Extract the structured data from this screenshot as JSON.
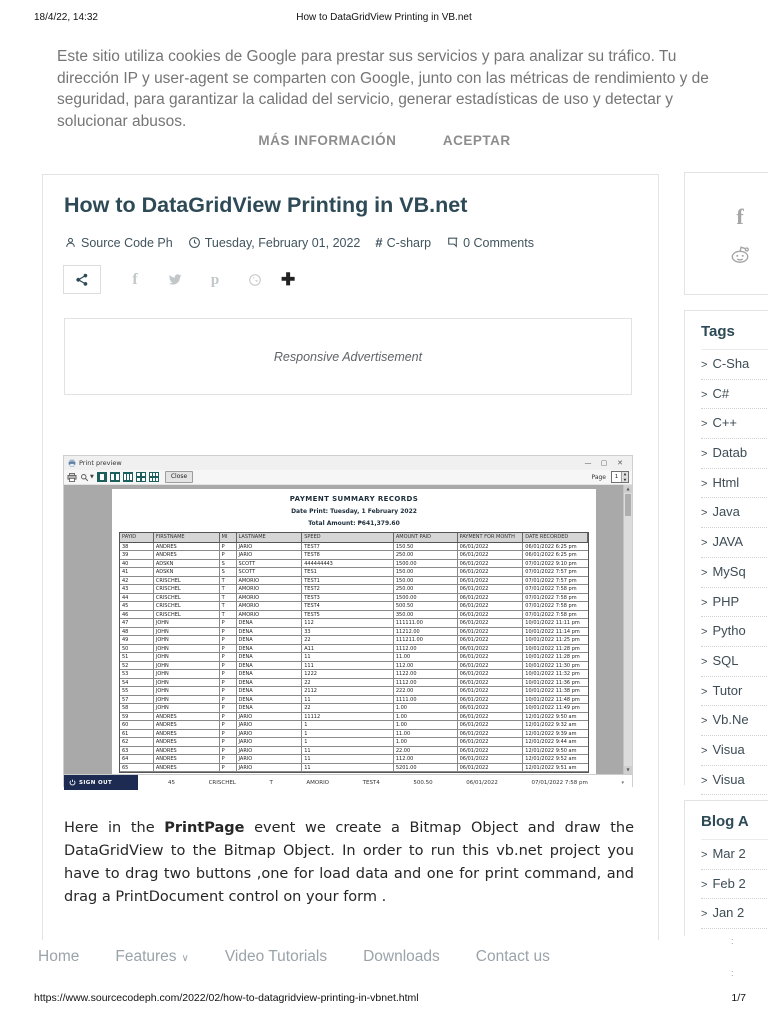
{
  "print_header": {
    "datetime": "18/4/22, 14:32",
    "title": "How to DataGridView Printing in VB.net"
  },
  "cookie_notice": {
    "text": "Este sitio utiliza cookies de Google para prestar sus servicios y para analizar su tráfico. Tu dirección IP y user-agent se comparten con Google, junto con las métricas de rendimiento y de seguridad, para garantizar la calidad del servicio, generar estadísticas de uso y detectar y solucionar abusos.",
    "more_label": "MÁS INFORMACIÓN",
    "accept_label": "ACEPTAR"
  },
  "article": {
    "title": "How to DataGridView Printing in VB.net",
    "author": "Source Code Ph",
    "date": "Tuesday, February 01, 2022",
    "tag": "C-sharp",
    "comments": "0 Comments",
    "ad_label": "Responsive Advertisement",
    "paragraph": {
      "before": "Here in the ",
      "bold": "PrintPage",
      "after": " event we create a Bitmap Object and draw the DataGridView to the Bitmap Object. In order to run this vb.net project you have to drag two buttons ,one for load data and one for print command, and drag a PrintDocument control on your form ."
    }
  },
  "preview_window": {
    "title": "Print preview",
    "close_label": "Close",
    "page_label": "Page",
    "page_value": "1",
    "minimize_glyph": "—",
    "maximize_glyph": "▢",
    "close_glyph": "✕",
    "report": {
      "title": "PAYMENT SUMMARY RECORDS",
      "date_line": "Date Print: Tuesday, 1 February 2022",
      "total_line": "Total Amount: ₱641,379.60",
      "columns": [
        "PAYID",
        "FIRSTNAME",
        "MI",
        "LASTNAME",
        "SPEED",
        "AMOUNT PAID",
        "PAYMENT FOR MONTH",
        "DATE RECORDED"
      ],
      "rows": [
        [
          "38",
          "ANDRES",
          "P",
          "JARIO",
          "TEST7",
          "150.50",
          "06/01/2022",
          "06/01/2022 6:25 pm"
        ],
        [
          "39",
          "ANDRES",
          "P",
          "JARIO",
          "TEST8",
          "250.00",
          "06/01/2022",
          "06/01/2022 6:25 pm"
        ],
        [
          "40",
          "ADSKN",
          "S",
          "SCOTT",
          "444444443",
          "1500.00",
          "06/01/2022",
          "07/01/2022 9:10 pm"
        ],
        [
          "41",
          "ADSKN",
          "S",
          "SCOTT",
          "TES1",
          "150.00",
          "06/01/2022",
          "07/01/2022 7:57 pm"
        ],
        [
          "42",
          "CRISCHEL",
          "T",
          "AMORIO",
          "TEST1",
          "150.00",
          "06/01/2022",
          "07/01/2022 7:57 pm"
        ],
        [
          "43",
          "CRISCHEL",
          "T",
          "AMORIO",
          "TEST2",
          "250.00",
          "06/01/2022",
          "07/01/2022 7:58 pm"
        ],
        [
          "44",
          "CRISCHEL",
          "T",
          "AMORIO",
          "TEST3",
          "1500.00",
          "06/01/2022",
          "07/01/2022 7:58 pm"
        ],
        [
          "45",
          "CRISCHEL",
          "T",
          "AMORIO",
          "TEST4",
          "500.50",
          "06/01/2022",
          "07/01/2022 7:58 pm"
        ],
        [
          "46",
          "CRISCHEL",
          "T",
          "AMORIO",
          "TEST5",
          "350.00",
          "06/01/2022",
          "07/01/2022 7:58 pm"
        ],
        [
          "47",
          "JOHN",
          "P",
          "DENA",
          "112",
          "111111.00",
          "06/01/2022",
          "10/01/2022 11:11 pm"
        ],
        [
          "48",
          "JOHN",
          "P",
          "DENA",
          "33",
          "11212.00",
          "06/01/2022",
          "10/01/2022 11:14 pm"
        ],
        [
          "49",
          "JOHN",
          "P",
          "DENA",
          "22",
          "111211.00",
          "06/01/2022",
          "10/01/2022 11:25 pm"
        ],
        [
          "50",
          "JOHN",
          "P",
          "DENA",
          "A11",
          "1112.00",
          "06/01/2022",
          "10/01/2022 11:28 pm"
        ],
        [
          "51",
          "JOHN",
          "P",
          "DENA",
          "11",
          "11.00",
          "06/01/2022",
          "10/01/2022 11:28 pm"
        ],
        [
          "52",
          "JOHN",
          "P",
          "DENA",
          "111",
          "112.00",
          "06/01/2022",
          "10/01/2022 11:30 pm"
        ],
        [
          "53",
          "JOHN",
          "P",
          "DENA",
          "1222",
          "1122.00",
          "06/01/2022",
          "10/01/2022 11:32 pm"
        ],
        [
          "54",
          "JOHN",
          "P",
          "DENA",
          "22",
          "1112.00",
          "06/01/2022",
          "10/01/2022 11:36 pm"
        ],
        [
          "55",
          "JOHN",
          "P",
          "DENA",
          "2112",
          "222.00",
          "06/01/2022",
          "10/01/2022 11:38 pm"
        ],
        [
          "57",
          "JOHN",
          "P",
          "DENA",
          "11",
          "1111.00",
          "06/01/2022",
          "10/01/2022 11:48 pm"
        ],
        [
          "58",
          "JOHN",
          "P",
          "DENA",
          "22",
          "1.00",
          "06/01/2022",
          "10/01/2022 11:49 pm"
        ],
        [
          "59",
          "ANDRES",
          "P",
          "JARIO",
          "11112",
          "1.00",
          "06/01/2022",
          "12/01/2022 9:50 am"
        ],
        [
          "60",
          "ANDRES",
          "P",
          "JARIO",
          "1",
          "1.00",
          "06/01/2022",
          "12/01/2022 9:32 am"
        ],
        [
          "61",
          "ANDRES",
          "P",
          "JARIO",
          "1",
          "11.00",
          "06/01/2022",
          "12/01/2022 9:39 am"
        ],
        [
          "62",
          "ANDRES",
          "P",
          "JARIO",
          "1",
          "1.00",
          "06/01/2022",
          "12/01/2022 9:44 am"
        ],
        [
          "63",
          "ANDRES",
          "P",
          "JARIO",
          "11",
          "22.00",
          "06/01/2022",
          "12/01/2022 9:50 am"
        ],
        [
          "64",
          "ANDRES",
          "P",
          "JARIO",
          "11",
          "112.00",
          "06/01/2022",
          "12/01/2022 9:52 am"
        ],
        [
          "65",
          "ANDRES",
          "P",
          "JARIO",
          "11",
          "5201.00",
          "06/01/2022",
          "12/01/2022 9:51 am"
        ]
      ]
    },
    "signout_label": "SIGN OUT",
    "selected_row": [
      "45",
      "CRISCHEL",
      "T",
      "AMORIO",
      "TEST4",
      "500.50",
      "06/01/2022",
      "07/01/2022 7:58 pm"
    ]
  },
  "sidebar": {
    "tags_title": "Tags",
    "tags": [
      "C-Sha",
      "C#",
      "C++",
      "Datab",
      "Html",
      "Java",
      "JAVA",
      "MySq",
      "PHP",
      "Pytho",
      "SQL",
      "Tutor",
      "Vb.Ne",
      "Visua",
      "Visua"
    ],
    "archive_title": "Blog A",
    "archive": [
      "Mar 2",
      "Feb 2",
      "Jan 2"
    ],
    "fragments": [
      ":",
      ":"
    ]
  },
  "footer": {
    "nav": [
      "Home",
      "Features",
      "Video Tutorials",
      "Downloads",
      "Contact us"
    ],
    "url": "https://www.sourcecodeph.com/2022/02/how-to-datagridview-printing-in-vbnet.html",
    "page": "1/7"
  },
  "colors": {
    "accent": "#2d4a56",
    "teal_button": "#1d5f5c",
    "signout_bar": "#1d2b52",
    "preview_bg": "#a9a9a9"
  }
}
